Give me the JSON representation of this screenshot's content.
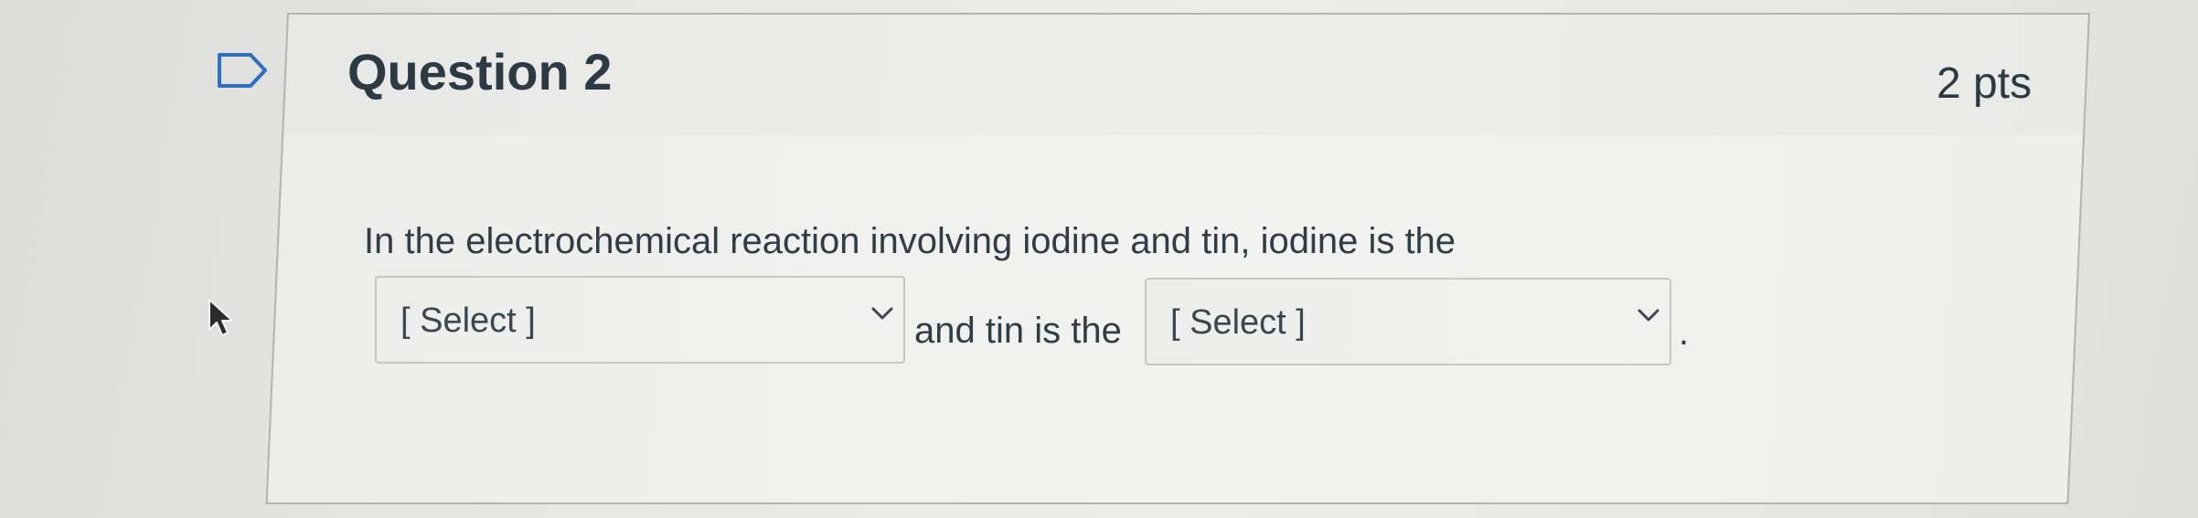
{
  "question": {
    "title": "Question 2",
    "points": "2 pts",
    "text_part1": "In the electrochemical reaction involving iodine and tin, iodine is the",
    "text_part2": "and tin is the",
    "text_end": "."
  },
  "selects": [
    {
      "value": "[ Select ]"
    },
    {
      "value": "[ Select ]"
    }
  ],
  "icons": {
    "flag": "flag-bookmark-icon",
    "cursor": "mouse-pointer-icon",
    "chevron": "chevron-down-icon"
  },
  "colors": {
    "text": "#2d3b45",
    "border": "#b3b3b1",
    "background": "#e9e9e7"
  }
}
